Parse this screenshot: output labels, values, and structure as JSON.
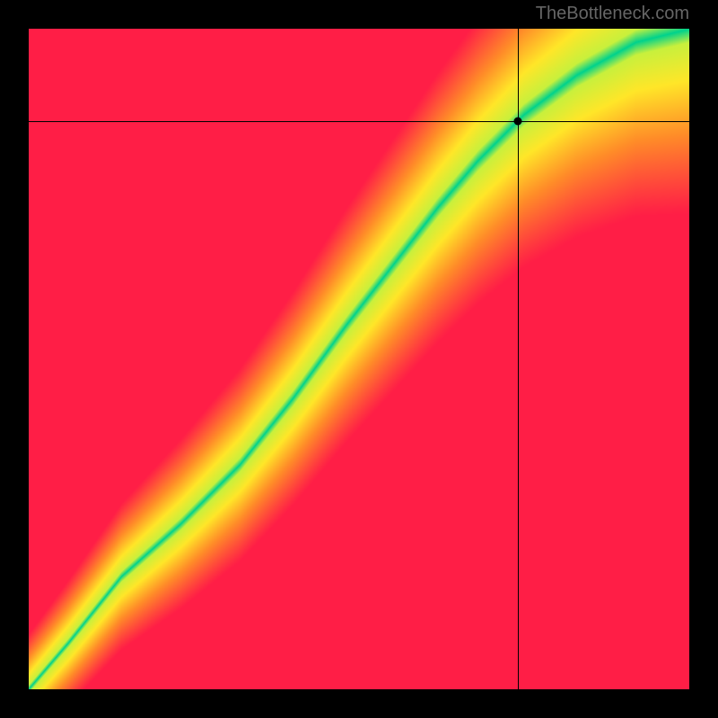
{
  "watermark": "TheBottleneck.com",
  "chart_data": {
    "type": "heatmap",
    "title": "",
    "xlabel": "",
    "ylabel": "",
    "xlim": [
      0,
      100
    ],
    "ylim": [
      0,
      100
    ],
    "grid_size": 100,
    "optimal_curve": [
      {
        "x": 0,
        "y": 0
      },
      {
        "x": 6,
        "y": 7
      },
      {
        "x": 14,
        "y": 17
      },
      {
        "x": 23,
        "y": 25
      },
      {
        "x": 32,
        "y": 34
      },
      {
        "x": 40,
        "y": 44
      },
      {
        "x": 48,
        "y": 55
      },
      {
        "x": 55,
        "y": 64
      },
      {
        "x": 62,
        "y": 73
      },
      {
        "x": 68,
        "y": 80
      },
      {
        "x": 75,
        "y": 87
      },
      {
        "x": 83,
        "y": 93
      },
      {
        "x": 92,
        "y": 98
      },
      {
        "x": 100,
        "y": 100
      }
    ],
    "band_width_frac": 0.07,
    "color_stops": [
      {
        "t": 0.0,
        "r": 255,
        "g": 30,
        "b": 70
      },
      {
        "t": 0.4,
        "r": 255,
        "g": 140,
        "b": 40
      },
      {
        "t": 0.7,
        "r": 255,
        "g": 230,
        "b": 40
      },
      {
        "t": 0.92,
        "r": 200,
        "g": 240,
        "b": 60
      },
      {
        "t": 1.0,
        "r": 0,
        "g": 210,
        "b": 140
      }
    ],
    "marker": {
      "x": 74,
      "y": 86
    },
    "crosshair": {
      "x": 74,
      "y": 86
    }
  }
}
